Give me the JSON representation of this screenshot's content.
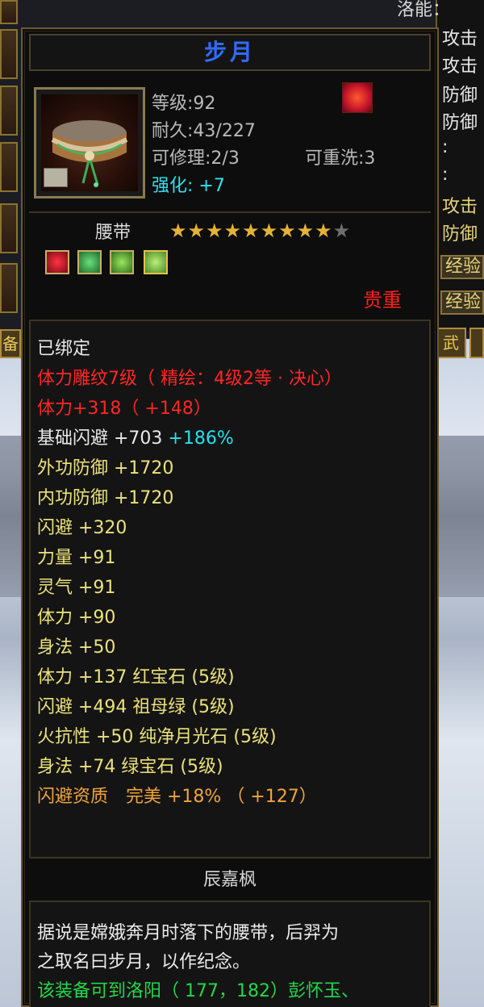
{
  "top_right_text": "洛能：",
  "right_panel": {
    "labels": [
      "攻击",
      "攻击",
      "防御",
      "防御",
      ":",
      ":",
      "攻击",
      "防御"
    ],
    "buttons": [
      "经验",
      "经验"
    ],
    "tab": "武"
  },
  "left_panel": {
    "tab": "备"
  },
  "item": {
    "name": "步月",
    "level_label": "等级:",
    "level": "92",
    "durability_label": "耐久:",
    "durability": "43/227",
    "repair_label": "可修理:",
    "repair": "2/3",
    "rewash_label": "可重洗:",
    "rewash": "3",
    "enhance_label": "强化:",
    "enhance": "+7",
    "category": "腰带",
    "stars_filled": 9,
    "stars_total": 10,
    "rarity": "贵重",
    "gem_icons": [
      "ruby-icon",
      "emerald-icon",
      "green-gem-icon",
      "jade-gem-icon"
    ]
  },
  "attributes": [
    {
      "text": "已绑定",
      "color": "#e9e9e9"
    },
    {
      "text": "体力雕纹7级（ 精绘：4级2等 · 决心）",
      "color": "#ff2626"
    },
    {
      "text": "体力+318（ +148）",
      "color": "#ff2626"
    },
    {
      "text": "基础闪避 +703",
      "extra": "+186%",
      "color": "#e9e9e9",
      "extra_color": "#25e0f0"
    },
    {
      "text": "外功防御 +1720",
      "color": "#ece27a"
    },
    {
      "text": "内功防御 +1720",
      "color": "#ece27a"
    },
    {
      "text": "闪避 +320",
      "color": "#ece27a"
    },
    {
      "text": "力量 +91",
      "color": "#ece27a"
    },
    {
      "text": "灵气 +91",
      "color": "#ece27a"
    },
    {
      "text": "体力 +90",
      "color": "#ece27a"
    },
    {
      "text": "身法 +50",
      "color": "#ece27a"
    },
    {
      "text": "体力 +137 红宝石 (5级)",
      "color": "#ece27a"
    },
    {
      "text": "闪避 +494 祖母绿 (5级)",
      "color": "#ece27a"
    },
    {
      "text": "火抗性 +50 纯净月光石 (5级)",
      "color": "#ece27a"
    },
    {
      "text": "身法 +74 绿宝石 (5级)",
      "color": "#ece27a"
    },
    {
      "text": "闪避资质　完美 +18% （ +127）",
      "color": "#f0a43a"
    }
  ],
  "author": "辰嘉枫",
  "description": [
    {
      "text": "据说是嫦娥奔月时落下的腰带，后羿为",
      "color": "#ececec"
    },
    {
      "text": "之取名曰步月，以作纪念。",
      "color": "#ececec"
    },
    {
      "text": "该装备可到洛阳（ 177，182）彭怀玉、",
      "color": "#22d84a"
    }
  ]
}
